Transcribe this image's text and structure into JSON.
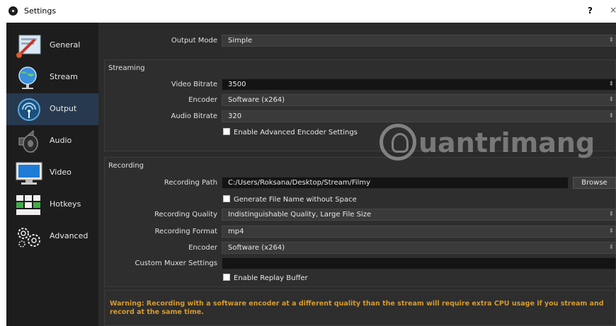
{
  "window": {
    "title": "Settings",
    "help": "?",
    "close": "×"
  },
  "sidebar": {
    "items": [
      {
        "label": "General",
        "icon": "general-icon",
        "active": false
      },
      {
        "label": "Stream",
        "icon": "globe-icon",
        "active": false
      },
      {
        "label": "Output",
        "icon": "output-icon",
        "active": true
      },
      {
        "label": "Audio",
        "icon": "speaker-icon",
        "active": false
      },
      {
        "label": "Video",
        "icon": "monitor-icon",
        "active": false
      },
      {
        "label": "Hotkeys",
        "icon": "keyboard-icon",
        "active": false
      },
      {
        "label": "Advanced",
        "icon": "gears-icon",
        "active": false
      }
    ]
  },
  "output": {
    "mode_label": "Output Mode",
    "mode_value": "Simple"
  },
  "streaming": {
    "title": "Streaming",
    "video_bitrate_label": "Video Bitrate",
    "video_bitrate_value": "3500",
    "encoder_label": "Encoder",
    "encoder_value": "Software (x264)",
    "audio_bitrate_label": "Audio Bitrate",
    "audio_bitrate_value": "320",
    "advanced_encoder_label": "Enable Advanced Encoder Settings"
  },
  "recording": {
    "title": "Recording",
    "path_label": "Recording Path",
    "path_value": "C:/Users/Roksana/Desktop/Stream/Filmy",
    "browse_label": "Browse",
    "no_space_label": "Generate File Name without Space",
    "quality_label": "Recording Quality",
    "quality_value": "Indistinguishable Quality, Large File Size",
    "format_label": "Recording Format",
    "format_value": "mp4",
    "encoder_label": "Encoder",
    "encoder_value": "Software (x264)",
    "muxer_label": "Custom Muxer Settings",
    "muxer_value": "",
    "replay_label": "Enable Replay Buffer"
  },
  "warning": "Warning: Recording with a software encoder at a different quality than the stream will require extra CPU usage if you stream and record at the same time.",
  "watermark": "uantrimang",
  "colors": {
    "sidebar_active": "#27394f",
    "warning": "#d59b2f",
    "background": "#2b2b2b"
  }
}
